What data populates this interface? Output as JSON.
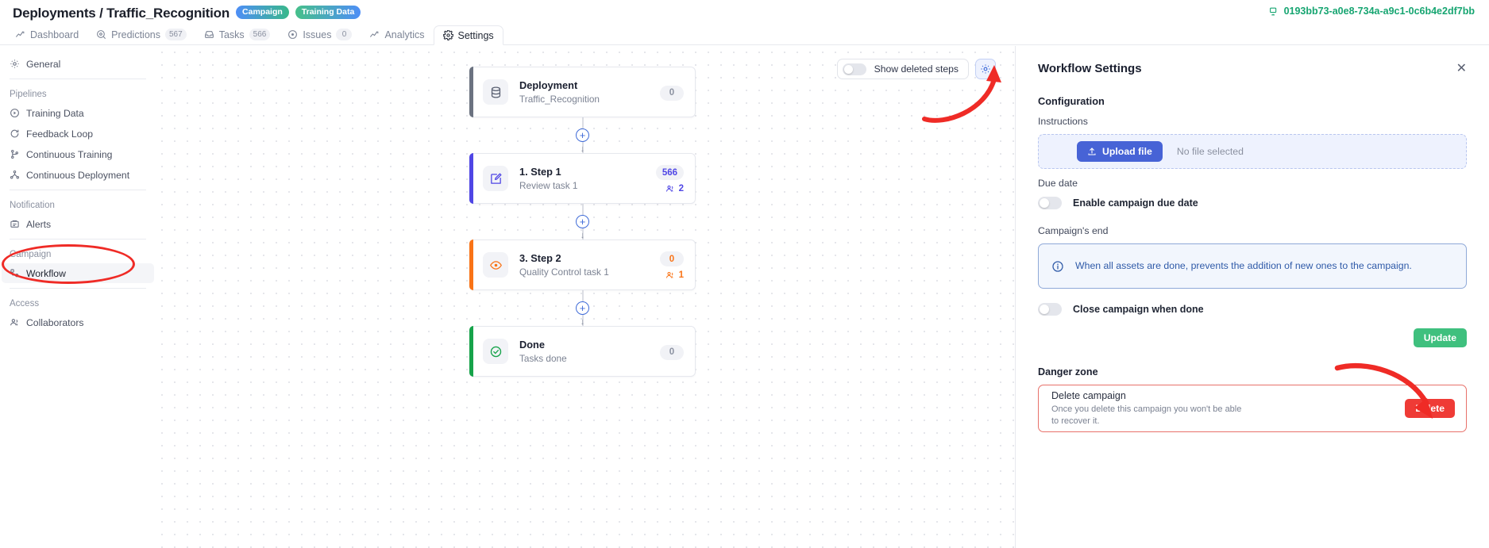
{
  "header": {
    "breadcrumb": "Deployments / Traffic_Recognition",
    "tags": [
      {
        "label": "Campaign",
        "color": "#4e8ef7"
      },
      {
        "label": "Training Data",
        "color": "#46c08a"
      }
    ],
    "deployment_id": "0193bb73-a0e8-734a-a9c1-0c6b4e2df7bb",
    "deployment_id_color": "#16a571"
  },
  "tabs": [
    {
      "label": "Dashboard",
      "icon": "chart-line-icon",
      "count": null,
      "active": false
    },
    {
      "label": "Predictions",
      "icon": "target-icon",
      "count": "567",
      "active": false
    },
    {
      "label": "Tasks",
      "icon": "inbox-icon",
      "count": "566",
      "active": false
    },
    {
      "label": "Issues",
      "icon": "circle-dot-icon",
      "count": "0",
      "active": false
    },
    {
      "label": "Analytics",
      "icon": "chart-line-icon",
      "count": null,
      "active": false
    },
    {
      "label": "Settings",
      "icon": "gear-icon",
      "count": null,
      "active": true
    }
  ],
  "sidebar": {
    "groups": [
      {
        "label": null,
        "items": [
          {
            "label": "General",
            "icon": "gear-icon",
            "selected": false
          }
        ]
      },
      {
        "label": "Pipelines",
        "items": [
          {
            "label": "Training Data",
            "icon": "play-circle-icon",
            "selected": false
          },
          {
            "label": "Feedback Loop",
            "icon": "refresh-icon",
            "selected": false
          },
          {
            "label": "Continuous Training",
            "icon": "branch-icon",
            "selected": false
          },
          {
            "label": "Continuous Deployment",
            "icon": "network-icon",
            "selected": false
          }
        ]
      },
      {
        "label": "Notification",
        "items": [
          {
            "label": "Alerts",
            "icon": "bell-box-icon",
            "selected": false
          }
        ]
      },
      {
        "label": "Campaign",
        "items": [
          {
            "label": "Workflow",
            "icon": "workflow-icon",
            "selected": true
          }
        ]
      },
      {
        "label": "Access",
        "items": [
          {
            "label": "Collaborators",
            "icon": "users-icon",
            "selected": false
          }
        ]
      }
    ]
  },
  "canvas": {
    "toolbar": {
      "show_deleted_label": "Show deleted steps",
      "show_deleted_on": false,
      "settings_icon": "gear-icon"
    },
    "add_step_icon": "plus-circle-icon",
    "steps": [
      {
        "title": "Deployment",
        "subtitle": "Traffic_Recognition",
        "icon": "database-icon",
        "accent": "#6b7280",
        "count": "0",
        "count_color": "#8b91a0",
        "assignees": null
      },
      {
        "title": "1. Step 1",
        "subtitle": "Review task 1",
        "icon": "edit-square-icon",
        "accent": "#4f46e5",
        "count": "566",
        "count_color": "#4f46e5",
        "assignees": "2"
      },
      {
        "title": "3. Step 2",
        "subtitle": "Quality Control task 1",
        "icon": "eye-target-icon",
        "accent": "#f97316",
        "count": "0",
        "count_color": "#f97316",
        "assignees": "1"
      },
      {
        "title": "Done",
        "subtitle": "Tasks done",
        "icon": "check-circle-icon",
        "accent": "#16a34a",
        "count": "0",
        "count_color": "#8b91a0",
        "assignees": null
      }
    ]
  },
  "panel": {
    "title": "Workflow Settings",
    "close_icon": "close-icon",
    "configuration_title": "Configuration",
    "instructions_label": "Instructions",
    "upload_button": "Upload file",
    "upload_icon": "upload-icon",
    "no_file_text": "No file selected",
    "due_date_label": "Due date",
    "enable_due_date_label": "Enable campaign due date",
    "enable_due_date_on": false,
    "campaign_end_label": "Campaign's end",
    "info_icon": "info-icon",
    "info_text": "When all assets are done, prevents the addition of new ones to the campaign.",
    "close_when_done_label": "Close campaign when done",
    "close_when_done_on": false,
    "update_button": "Update",
    "update_color": "#3fc07e",
    "danger_zone_title": "Danger zone",
    "delete_title": "Delete campaign",
    "delete_desc": "Once you delete this campaign you won't be able to recover it.",
    "delete_button": "Delete",
    "delete_color": "#ef3b36"
  },
  "annotations": {
    "highlight_color": "#ef2b26",
    "ellipse_target": "sidebar-item-workflow",
    "arrow_1_target": "workflow-settings-gear-button",
    "arrow_2_target": "delete-campaign-button"
  }
}
